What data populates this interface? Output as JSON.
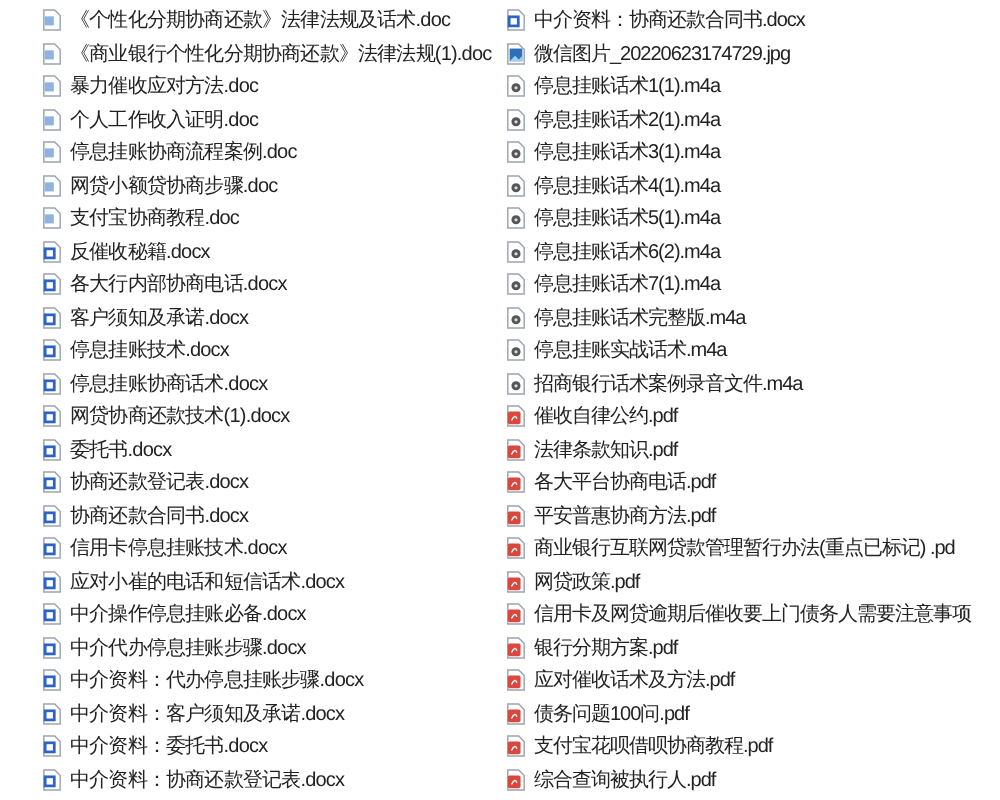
{
  "columns": [
    {
      "files": [
        {
          "name": "《个性化分期协商还款》法律法规及话术.doc",
          "kind": "doc"
        },
        {
          "name": "《商业银行个性化分期协商还款》法律法规(1).doc",
          "kind": "doc"
        },
        {
          "name": "暴力催收应对方法.doc",
          "kind": "doc"
        },
        {
          "name": "个人工作收入证明.doc",
          "kind": "doc"
        },
        {
          "name": "停息挂账协商流程案例.doc",
          "kind": "doc"
        },
        {
          "name": "网贷小额贷协商步骤.doc",
          "kind": "doc"
        },
        {
          "name": "支付宝协商教程.doc",
          "kind": "doc"
        },
        {
          "name": "反催收秘籍.docx",
          "kind": "docx"
        },
        {
          "name": "各大行内部协商电话.docx",
          "kind": "docx"
        },
        {
          "name": "客户须知及承诺.docx",
          "kind": "docx"
        },
        {
          "name": "停息挂账技术.docx",
          "kind": "docx"
        },
        {
          "name": "停息挂账协商话术.docx",
          "kind": "docx"
        },
        {
          "name": "网贷协商还款技术(1).docx",
          "kind": "docx"
        },
        {
          "name": "委托书.docx",
          "kind": "docx"
        },
        {
          "name": "协商还款登记表.docx",
          "kind": "docx"
        },
        {
          "name": "协商还款合同书.docx",
          "kind": "docx"
        },
        {
          "name": "信用卡停息挂账技术.docx",
          "kind": "docx"
        },
        {
          "name": "应对小崔的电话和短信话术.docx",
          "kind": "docx"
        },
        {
          "name": "中介操作停息挂账必备.docx",
          "kind": "docx"
        },
        {
          "name": "中介代办停息挂账步骤.docx",
          "kind": "docx"
        },
        {
          "name": "中介资料：代办停息挂账步骤.docx",
          "kind": "docx"
        },
        {
          "name": "中介资料：客户须知及承诺.docx",
          "kind": "docx"
        },
        {
          "name": "中介资料：委托书.docx",
          "kind": "docx"
        },
        {
          "name": "中介资料：协商还款登记表.docx",
          "kind": "docx"
        }
      ]
    },
    {
      "files": [
        {
          "name": "中介资料：协商还款合同书.docx",
          "kind": "docx"
        },
        {
          "name": "微信图片_20220623174729.jpg",
          "kind": "image"
        },
        {
          "name": "停息挂账话术1(1).m4a",
          "kind": "audio"
        },
        {
          "name": "停息挂账话术2(1).m4a",
          "kind": "audio"
        },
        {
          "name": "停息挂账话术3(1).m4a",
          "kind": "audio"
        },
        {
          "name": "停息挂账话术4(1).m4a",
          "kind": "audio"
        },
        {
          "name": "停息挂账话术5(1).m4a",
          "kind": "audio"
        },
        {
          "name": "停息挂账话术6(2).m4a",
          "kind": "audio"
        },
        {
          "name": "停息挂账话术7(1).m4a",
          "kind": "audio"
        },
        {
          "name": "停息挂账话术完整版.m4a",
          "kind": "audio"
        },
        {
          "name": "停息挂账实战话术.m4a",
          "kind": "audio"
        },
        {
          "name": "招商银行话术案例录音文件.m4a",
          "kind": "audio"
        },
        {
          "name": "催收自律公约.pdf",
          "kind": "pdf"
        },
        {
          "name": "法律条款知识.pdf",
          "kind": "pdf"
        },
        {
          "name": "各大平台协商电话.pdf",
          "kind": "pdf"
        },
        {
          "name": "平安普惠协商方法.pdf",
          "kind": "pdf"
        },
        {
          "name": "商业银行互联网贷款管理暂行办法(重点已标记) .pd",
          "kind": "pdf"
        },
        {
          "name": "网贷政策.pdf",
          "kind": "pdf"
        },
        {
          "name": "信用卡及网贷逾期后催收要上门债务人需要注意事项",
          "kind": "pdf"
        },
        {
          "name": "银行分期方案.pdf",
          "kind": "pdf"
        },
        {
          "name": "应对催收话术及方法.pdf",
          "kind": "pdf"
        },
        {
          "name": "债务问题100问.pdf",
          "kind": "pdf"
        },
        {
          "name": "支付宝花呗借呗协商教程.pdf",
          "kind": "pdf"
        },
        {
          "name": "综合查询被执行人.pdf",
          "kind": "pdf"
        }
      ]
    }
  ]
}
